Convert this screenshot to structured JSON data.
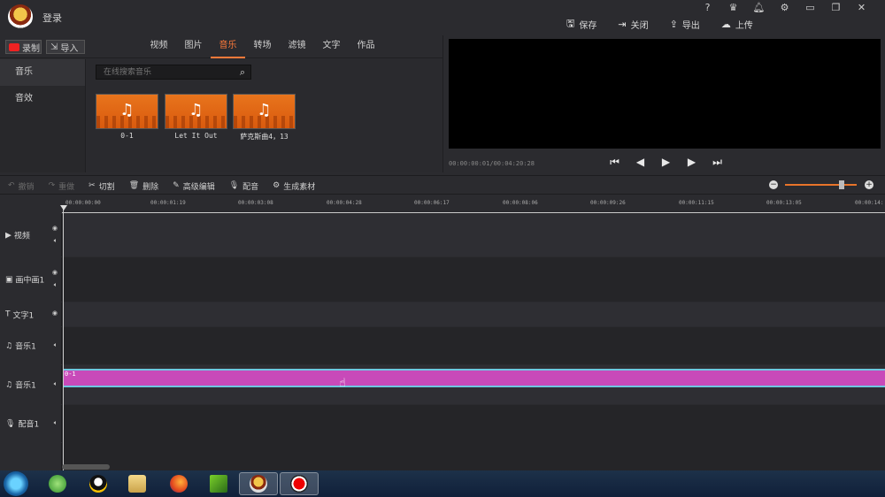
{
  "header": {
    "login": "登录",
    "actions": [
      {
        "label": "保存",
        "icon": "save-icon"
      },
      {
        "label": "关闭",
        "icon": "close-project-icon"
      },
      {
        "label": "导出",
        "icon": "export-icon"
      },
      {
        "label": "上传",
        "icon": "upload-icon"
      }
    ],
    "window_icons": [
      "?",
      "crown",
      "bell",
      "gear",
      "minimize",
      "maximize",
      "close"
    ]
  },
  "library": {
    "record_label": "录制",
    "import_label": "导入",
    "tabs": [
      "视频",
      "图片",
      "音乐",
      "转场",
      "滤镜",
      "文字",
      "作品"
    ],
    "active_tab": "音乐",
    "side": [
      "音乐",
      "音效"
    ],
    "search_placeholder": "在线搜索音乐",
    "items": [
      {
        "label": "0-1"
      },
      {
        "label": "Let It Out"
      },
      {
        "label": "萨克斯曲4，13"
      }
    ]
  },
  "preview": {
    "time": "00:00:00:01/00:04:20:28"
  },
  "edit_toolbar": {
    "tools": [
      {
        "label": "撤销",
        "icon": "undo-icon",
        "disabled": true
      },
      {
        "label": "重做",
        "icon": "redo-icon",
        "disabled": true
      },
      {
        "label": "切割",
        "icon": "scissors-icon",
        "disabled": false
      },
      {
        "label": "删除",
        "icon": "trash-icon",
        "disabled": false
      },
      {
        "label": "高级编辑",
        "icon": "pencil-icon",
        "disabled": false
      },
      {
        "label": "配音",
        "icon": "microphone-icon",
        "disabled": false
      },
      {
        "label": "生成素材",
        "icon": "film-reel-icon",
        "disabled": false
      }
    ]
  },
  "timeline": {
    "ruler": [
      "00:00:00:00",
      "00:00:01:19",
      "00:00:03:08",
      "00:00:04:28",
      "00:00:06:17",
      "00:00:08:06",
      "00:00:09:26",
      "00:00:11:15",
      "00:00:13:05",
      "00:00:14:"
    ],
    "tracks": [
      {
        "label": "视频",
        "icon": "video-track-icon"
      },
      {
        "label": "画中画1",
        "icon": "pip-track-icon"
      },
      {
        "label": "文字1",
        "icon": "text-track-icon"
      },
      {
        "label": "音乐1",
        "icon": "music-track-icon"
      },
      {
        "label": "音乐1",
        "icon": "music-track-icon"
      },
      {
        "label": "配音1",
        "icon": "voiceover-track-icon"
      }
    ],
    "clip_label": "0-1"
  },
  "colors": {
    "accent": "#ff7a3a",
    "clip": "#c84ab9",
    "clip_border": "#6fc7e0"
  }
}
